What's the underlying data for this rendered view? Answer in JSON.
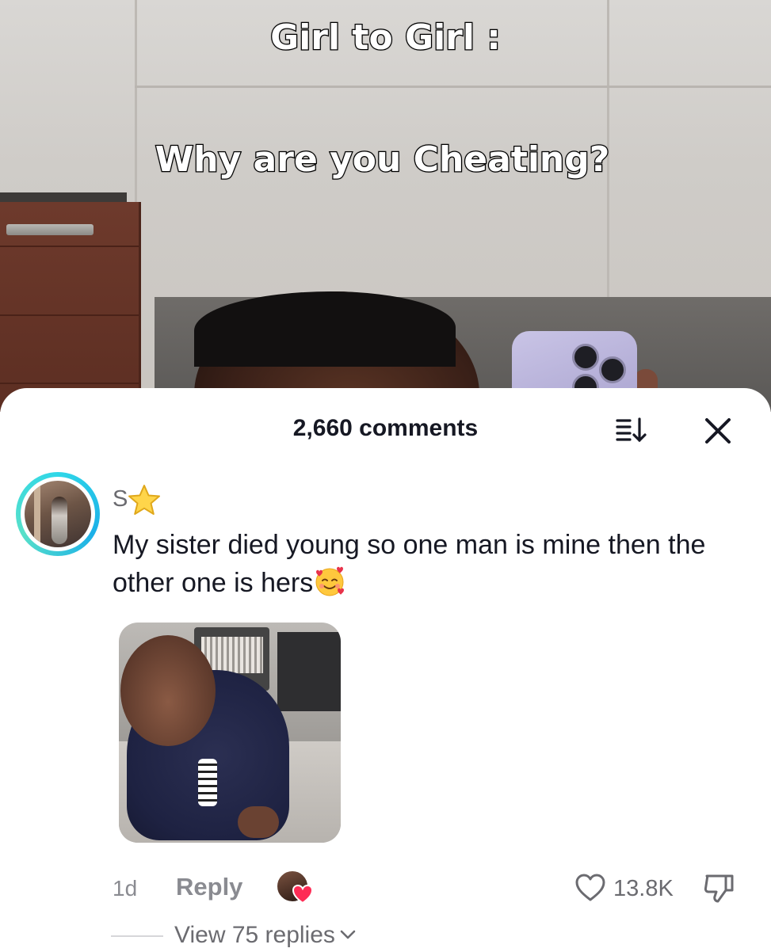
{
  "video": {
    "caption_line1": "Girl to Girl :",
    "caption_line2": "Why are you Cheating?"
  },
  "comments_sheet": {
    "comment_count_label": "2,660 comments",
    "icons": {
      "sort": "sort-icon",
      "close": "close-icon"
    }
  },
  "comment": {
    "username": "S",
    "username_badge_icon": "star-emoji-icon",
    "text": "My sister died young so one man is mine then the other one is hers",
    "trailing_emoji_icon": "smiling-face-with-hearts-emoji",
    "attached_image": "photo of a baby",
    "time_ago": "1d",
    "reply_label": "Reply",
    "creator_liked_icon": "creator-liked-heart-icon",
    "like_count": "13.8K",
    "view_replies_label": "View 75 replies"
  },
  "colors": {
    "primary_text": "#161823",
    "secondary_text": "#8a8b91",
    "avatar_ring": "#2fd7e8",
    "heart_badge": "#fe2c55"
  }
}
